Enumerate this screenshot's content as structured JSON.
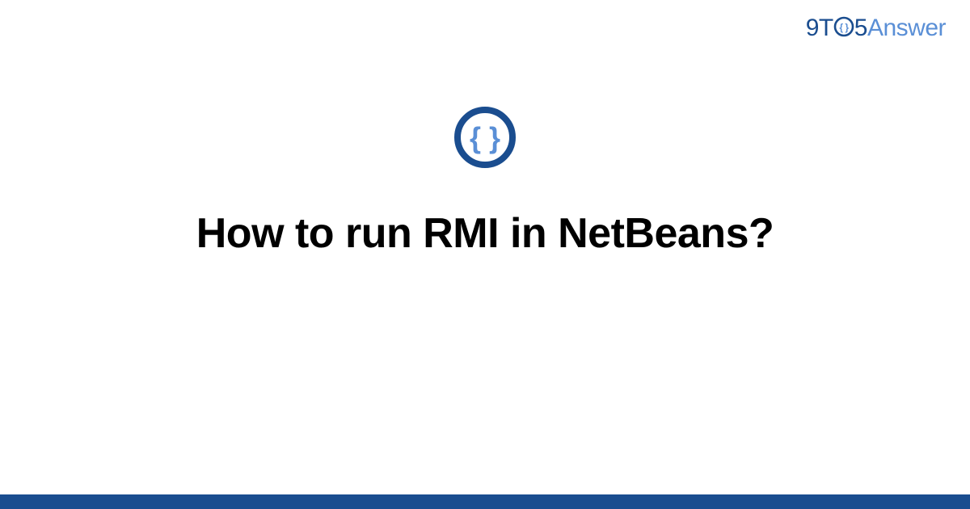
{
  "brand": {
    "part1": "9T",
    "part2": "5",
    "part3": "Answer"
  },
  "badge": {
    "name": "code-braces-icon",
    "ring_color": "#1a4d8f",
    "brace_color": "#5a8fd6"
  },
  "question": {
    "title": "How to run RMI in NetBeans?"
  },
  "footer": {
    "bar_color": "#1a4d8f"
  }
}
